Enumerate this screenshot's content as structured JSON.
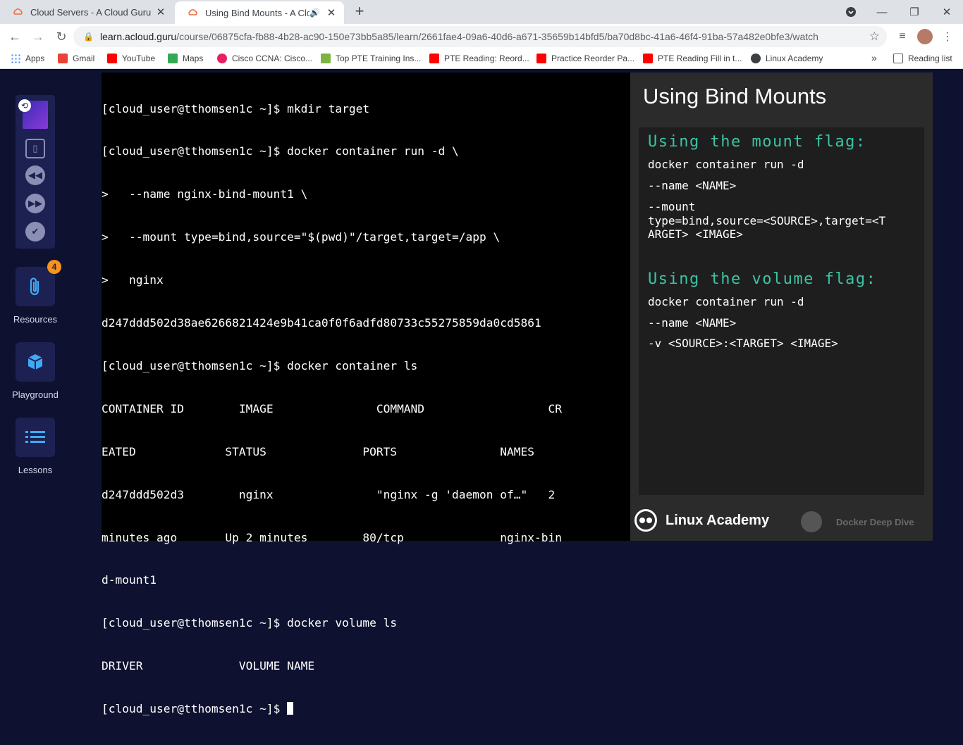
{
  "browser": {
    "tabs": [
      {
        "title": "Cloud Servers - A Cloud Guru",
        "active": false
      },
      {
        "title": "Using Bind Mounts - A Cloud Guru",
        "active": true
      }
    ],
    "url_host": "learn.acloud.guru",
    "url_path": "/course/06875cfa-fb88-4b28-ac90-150e73bb5a85/learn/2661fae4-09a6-40d6-a671-35659b14bfd5/ba70d8bc-41a6-46f4-91ba-57a482e0bfe3/watch",
    "bookmarks": [
      {
        "label": "Apps",
        "color": "#4285f4"
      },
      {
        "label": "Gmail",
        "color": "#ea4335"
      },
      {
        "label": "YouTube",
        "color": "#ff0000"
      },
      {
        "label": "Maps",
        "color": "#34a853"
      },
      {
        "label": "Cisco CCNA: Cisco...",
        "color": "#e91e63"
      },
      {
        "label": "Top PTE Training Ins...",
        "color": "#7cb342"
      },
      {
        "label": "PTE Reading: Reord...",
        "color": "#ff0000"
      },
      {
        "label": "Practice Reorder Pa...",
        "color": "#ff0000"
      },
      {
        "label": "PTE Reading Fill in t...",
        "color": "#ff0000"
      },
      {
        "label": "Linux Academy",
        "color": "#3c4043"
      }
    ],
    "more_bookmarks": "»",
    "reading_list": "Reading list"
  },
  "sidebar": {
    "resources_label": "Resources",
    "resources_badge": "4",
    "playground_label": "Playground",
    "lessons_label": "Lessons"
  },
  "terminal": {
    "lines": [
      "[cloud_user@tthomsen1c ~]$ mkdir target",
      "[cloud_user@tthomsen1c ~]$ docker container run -d \\",
      ">   --name nginx-bind-mount1 \\",
      ">   --mount type=bind,source=\"$(pwd)\"/target,target=/app \\",
      ">   nginx",
      "d247ddd502d38ae6266821424e9b41ca0f0f6adfd80733c55275859da0cd5861",
      "[cloud_user@tthomsen1c ~]$ docker container ls",
      "CONTAINER ID        IMAGE               COMMAND                  CR",
      "EATED             STATUS              PORTS               NAMES",
      "d247ddd502d3        nginx               \"nginx -g 'daemon of…\"   2",
      "minutes ago       Up 2 minutes        80/tcp              nginx-bin",
      "d-mount1",
      "[cloud_user@tthomsen1c ~]$ docker volume ls",
      "DRIVER              VOLUME NAME"
    ],
    "prompt": "[cloud_user@tthomsen1c ~]$ "
  },
  "slide": {
    "title": "Using Bind Mounts",
    "mount_heading": "Using the mount flag:",
    "mount_lines": [
      "docker container run -d",
      "--name <NAME>",
      "--mount\ntype=bind,source=<SOURCE>,target=<T\nARGET> <IMAGE>"
    ],
    "volume_heading": "Using the volume flag:",
    "volume_lines": [
      "docker container run -d",
      "--name <NAME>",
      "-v <SOURCE>:<TARGET> <IMAGE>"
    ],
    "brand": "Linux Academy",
    "course": "Docker Deep Dive"
  }
}
